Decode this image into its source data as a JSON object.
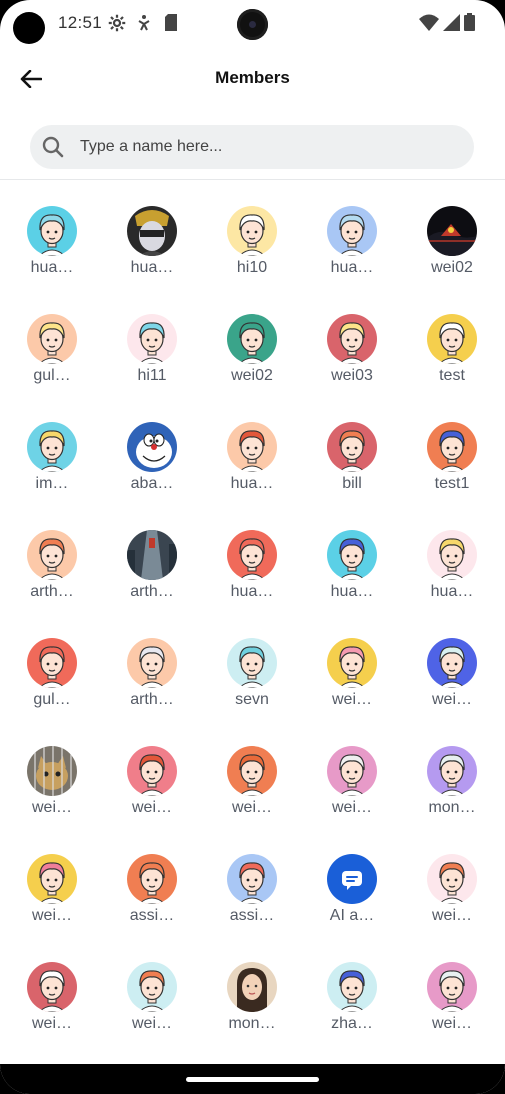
{
  "status_bar": {
    "time": "12:51",
    "icons": [
      "settings-gear-icon",
      "accessibility-icon",
      "sd-card-icon",
      "wifi-icon",
      "signal-icon",
      "battery-icon"
    ]
  },
  "header": {
    "title": "Members",
    "back_icon": "arrow-left-icon"
  },
  "search": {
    "placeholder": "Type a name here...",
    "value": ""
  },
  "members": [
    {
      "name": "hua…",
      "bg": "#5bd0e6",
      "skin": "#fde3d4",
      "hair": "#8fd8e8",
      "kind": "cartoon"
    },
    {
      "name": "hua…",
      "bg": "#2a2a2a",
      "skin": "#d9d9e0",
      "hair": "#c8a030",
      "kind": "photo-dark"
    },
    {
      "name": "hi10",
      "bg": "#fde7a4",
      "skin": "#fde3d4",
      "hair": "#ffffff",
      "kind": "cartoon"
    },
    {
      "name": "hua…",
      "bg": "#a9c7f5",
      "skin": "#fde3d4",
      "hair": "#b5dbf0",
      "kind": "cartoon"
    },
    {
      "name": "wei02",
      "bg": "#0d0d12",
      "skin": "#c0392b",
      "hair": "#000000",
      "kind": "photo-night"
    },
    {
      "name": "gul…",
      "bg": "#fcc9a9",
      "skin": "#fde3d4",
      "hair": "#fde48a",
      "kind": "cartoon"
    },
    {
      "name": "hi11",
      "bg": "#fde7ec",
      "skin": "#fde3d4",
      "hair": "#7ed6e8",
      "kind": "cartoon"
    },
    {
      "name": "wei02",
      "bg": "#3aa48a",
      "skin": "#fde3d4",
      "hair": "#3aa48a",
      "kind": "cartoon"
    },
    {
      "name": "wei03",
      "bg": "#d9646b",
      "skin": "#fde3d4",
      "hair": "#fde48a",
      "kind": "cartoon"
    },
    {
      "name": "test",
      "bg": "#f5cf4d",
      "skin": "#fde3d4",
      "hair": "#ffffff",
      "kind": "cartoon"
    },
    {
      "name": "im…",
      "bg": "#6ed3e6",
      "skin": "#fde3d4",
      "hair": "#f6d76b",
      "kind": "cartoon"
    },
    {
      "name": "aba…",
      "bg": "#2f63b8",
      "skin": "#ffffff",
      "hair": "#2f63b8",
      "kind": "doraemon"
    },
    {
      "name": "hua…",
      "bg": "#fcc9a9",
      "skin": "#fde3d4",
      "hair": "#e2573a",
      "kind": "cartoon"
    },
    {
      "name": "bill",
      "bg": "#d9646b",
      "skin": "#fde3d4",
      "hair": "#f07e52",
      "kind": "cartoon"
    },
    {
      "name": "test1",
      "bg": "#f07e52",
      "skin": "#fde3d4",
      "hair": "#4660d8",
      "kind": "cartoon"
    },
    {
      "name": "arth…",
      "bg": "#fcc9a9",
      "skin": "#fde3d4",
      "hair": "#f07e52",
      "kind": "cartoon"
    },
    {
      "name": "arth…",
      "bg": "#3a4550",
      "skin": "#7a8a96",
      "hair": "#c0392b",
      "kind": "photo-street"
    },
    {
      "name": "hua…",
      "bg": "#f06a5a",
      "skin": "#fde3d4",
      "hair": "#f06a5a",
      "kind": "cartoon"
    },
    {
      "name": "hua…",
      "bg": "#5bd0e6",
      "skin": "#fde3d4",
      "hair": "#4660d8",
      "kind": "cartoon"
    },
    {
      "name": "hua…",
      "bg": "#fde7ec",
      "skin": "#fde3d4",
      "hair": "#f6d76b",
      "kind": "cartoon"
    },
    {
      "name": "gul…",
      "bg": "#f06a5a",
      "skin": "#fde3d4",
      "hair": "#f06a5a",
      "kind": "cartoon"
    },
    {
      "name": "arth…",
      "bg": "#fcc9a9",
      "skin": "#fde3d4",
      "hair": "#e8e8f0",
      "kind": "cartoon"
    },
    {
      "name": "sevn",
      "bg": "#cdeef2",
      "skin": "#fde3d4",
      "hair": "#6fd0de",
      "kind": "cartoon"
    },
    {
      "name": "wei…",
      "bg": "#f5cf4d",
      "skin": "#fde3d4",
      "hair": "#f59ab0",
      "kind": "cartoon"
    },
    {
      "name": "wei…",
      "bg": "#4f63e6",
      "skin": "#fde3d4",
      "hair": "#d9f0f0",
      "kind": "cartoon"
    },
    {
      "name": "wei…",
      "bg": "#7a746a",
      "skin": "#c7a060",
      "hair": "#555",
      "kind": "photo-cat"
    },
    {
      "name": "wei…",
      "bg": "#f07e8a",
      "skin": "#fde3d4",
      "hair": "#e2573a",
      "kind": "cartoon"
    },
    {
      "name": "wei…",
      "bg": "#f07e52",
      "skin": "#fde3d4",
      "hair": "#e86a3a",
      "kind": "cartoon"
    },
    {
      "name": "wei…",
      "bg": "#e79ac8",
      "skin": "#fde3d4",
      "hair": "#f0f0f0",
      "kind": "cartoon"
    },
    {
      "name": "mon…",
      "bg": "#b59af0",
      "skin": "#fde3d4",
      "hair": "#e8f0f0",
      "kind": "cartoon"
    },
    {
      "name": "wei…",
      "bg": "#f5cf4d",
      "skin": "#fde3d4",
      "hair": "#f07e9a",
      "kind": "cartoon"
    },
    {
      "name": "assi…",
      "bg": "#f07e52",
      "skin": "#fde3d4",
      "hair": "#f07e52",
      "kind": "cartoon"
    },
    {
      "name": "assi…",
      "bg": "#a9c7f5",
      "skin": "#fde3d4",
      "hair": "#f06a5a",
      "kind": "cartoon"
    },
    {
      "name": "AI a…",
      "bg": "#1a5fd8",
      "skin": "#ffffff",
      "hair": "#1a5fd8",
      "kind": "bot"
    },
    {
      "name": "wei…",
      "bg": "#fde7ec",
      "skin": "#fde3d4",
      "hair": "#f07e52",
      "kind": "cartoon"
    },
    {
      "name": "wei…",
      "bg": "#d9646b",
      "skin": "#fde3d4",
      "hair": "#ffffff",
      "kind": "cartoon"
    },
    {
      "name": "wei…",
      "bg": "#cdeef2",
      "skin": "#fde3d4",
      "hair": "#f07e52",
      "kind": "cartoon"
    },
    {
      "name": "mon…",
      "bg": "#e8d6c0",
      "skin": "#f2d2b8",
      "hair": "#3a2a20",
      "kind": "photo-girl"
    },
    {
      "name": "zha…",
      "bg": "#cdeef2",
      "skin": "#fde3d4",
      "hair": "#4660d8",
      "kind": "cartoon"
    },
    {
      "name": "wei…",
      "bg": "#e79ac8",
      "skin": "#fde3d4",
      "hair": "#e8f0f0",
      "kind": "cartoon"
    }
  ]
}
